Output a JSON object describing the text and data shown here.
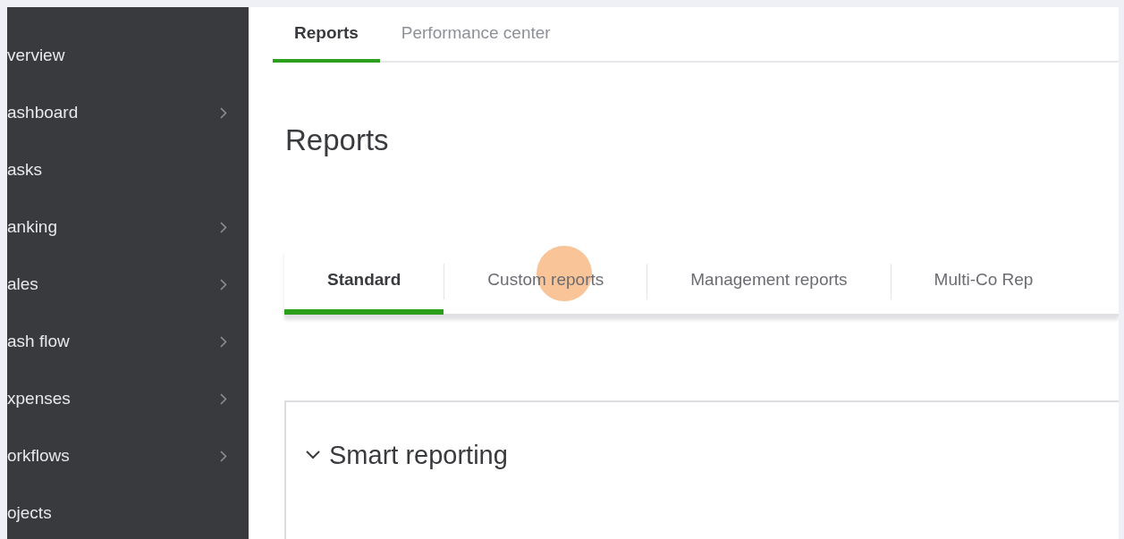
{
  "sidebar": {
    "items": [
      {
        "label": "verview",
        "has_submenu": false
      },
      {
        "label": "ashboard",
        "has_submenu": true
      },
      {
        "label": "asks",
        "has_submenu": false
      },
      {
        "label": "anking",
        "has_submenu": true
      },
      {
        "label": "ales",
        "has_submenu": true
      },
      {
        "label": "ash flow",
        "has_submenu": true
      },
      {
        "label": "xpenses",
        "has_submenu": true
      },
      {
        "label": "orkflows",
        "has_submenu": true
      },
      {
        "label": "ojects",
        "has_submenu": false
      }
    ]
  },
  "top_tabs": [
    {
      "label": "Reports",
      "selected": true
    },
    {
      "label": "Performance center",
      "selected": false
    }
  ],
  "heading": "Reports",
  "report_tabs": [
    {
      "label": "Standard",
      "selected": true
    },
    {
      "label": "Custom reports",
      "selected": false
    },
    {
      "label": "Management reports",
      "selected": false
    },
    {
      "label": "Multi-Co Rep",
      "selected": false
    }
  ],
  "section": {
    "title": "Smart reporting",
    "expanded": true
  }
}
